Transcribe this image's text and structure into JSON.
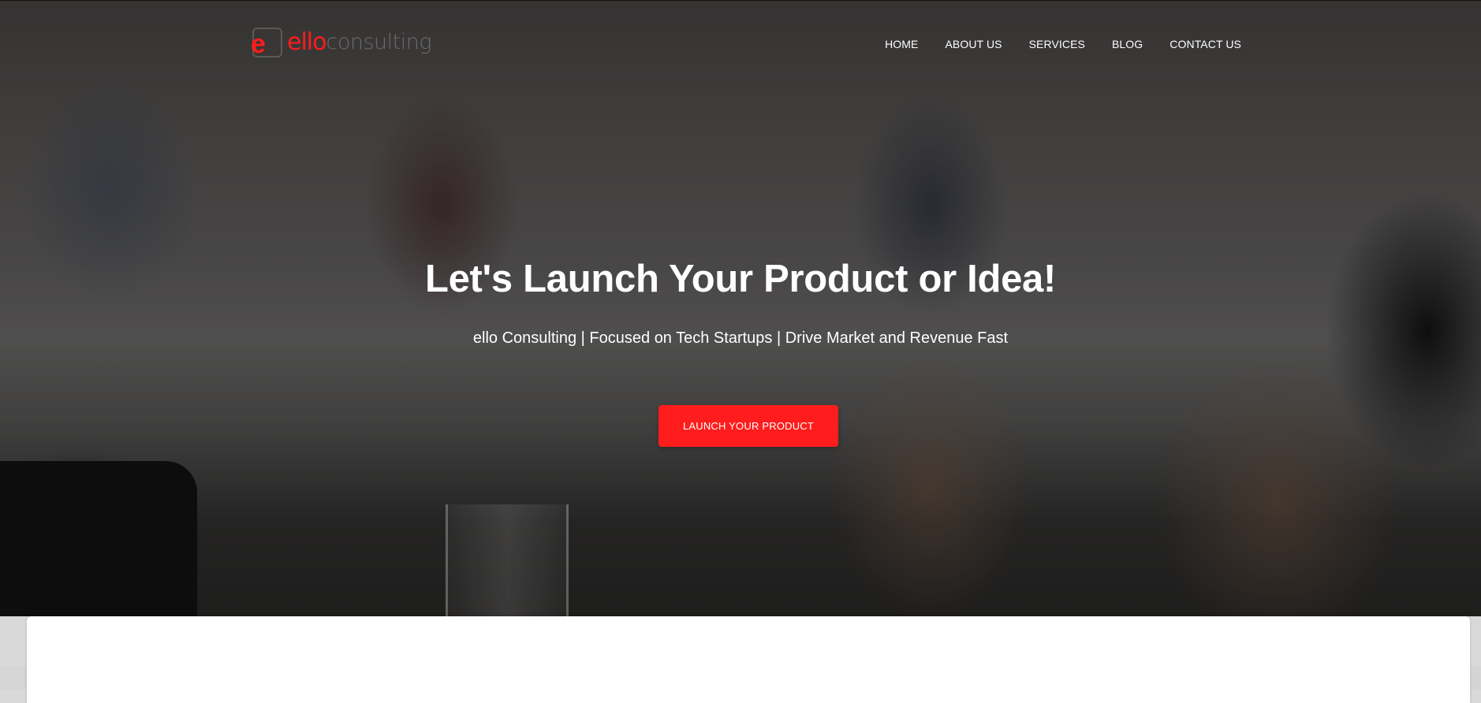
{
  "brand": {
    "logo_text_primary": "ello",
    "logo_text_secondary": "consulting",
    "logo_mark_letter": "e",
    "accent_color": "#ff1c1c"
  },
  "nav": {
    "items": [
      {
        "label": "HOME"
      },
      {
        "label": "ABOUT US"
      },
      {
        "label": "SERVICES"
      },
      {
        "label": "BLOG"
      },
      {
        "label": "CONTACT US"
      }
    ]
  },
  "hero": {
    "title": "Let's Launch Your Product or Idea!",
    "subtitle": "ello Consulting | Focused on Tech Startups | Drive Market and Revenue Fast",
    "cta_label": "LAUNCH YOUR PRODUCT"
  }
}
